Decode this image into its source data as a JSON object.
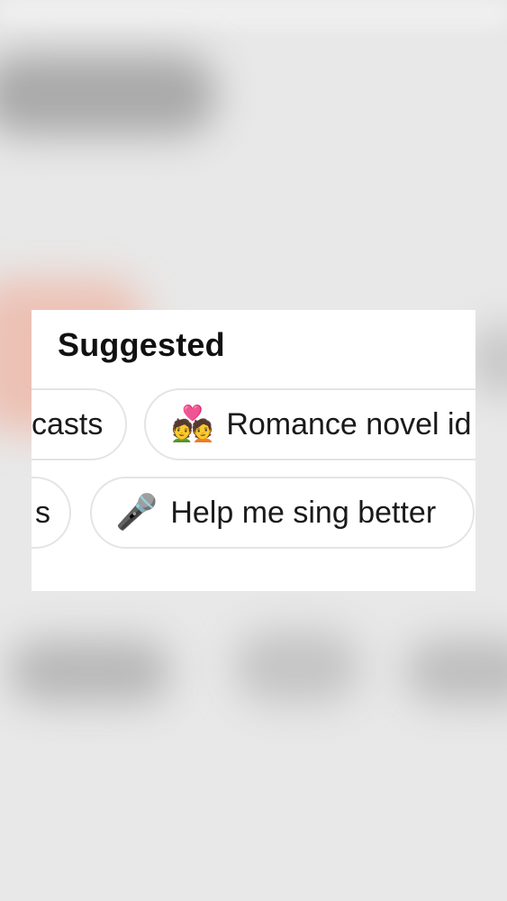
{
  "suggested": {
    "title": "Suggested",
    "chips_row1": [
      {
        "label": "casts",
        "icon": ""
      },
      {
        "label": "Romance novel id",
        "icon": "💑"
      }
    ],
    "chips_row2": [
      {
        "label": "s",
        "icon": ""
      },
      {
        "label": "Help me sing better",
        "icon": "🎤"
      }
    ]
  }
}
